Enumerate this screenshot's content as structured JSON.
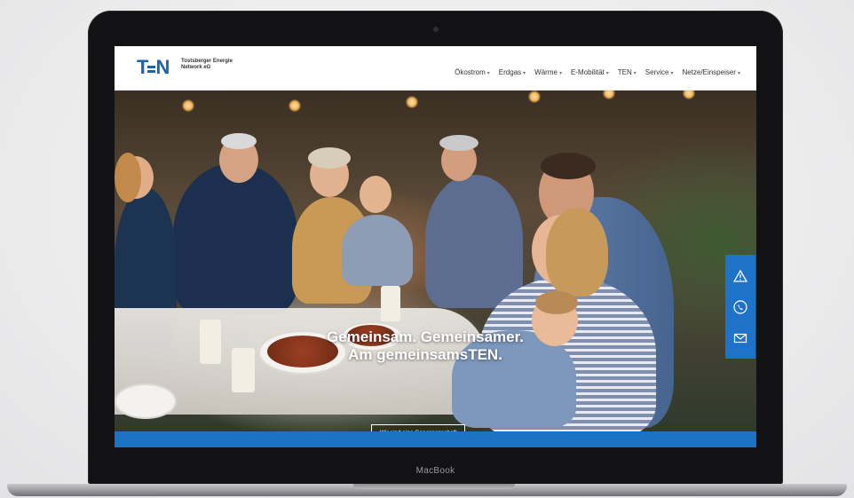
{
  "device": {
    "label": "MacBook"
  },
  "site": {
    "logo": {
      "mark": "TEN",
      "line1": "Tostsberger Energie",
      "line2": "Network eG"
    },
    "nav": [
      {
        "label": "Ökostrom"
      },
      {
        "label": "Erdgas"
      },
      {
        "label": "Wärme"
      },
      {
        "label": "E-Mobilität"
      },
      {
        "label": "TEN"
      },
      {
        "label": "Service"
      },
      {
        "label": "Netze/Einspeiser"
      }
    ],
    "hero": {
      "title_line1": "Gemeinsam. Gemeinsamer.",
      "title_line2": "Am gemeinsamsTEN.",
      "cta": "Wir sind eine Genossenschaft",
      "slides": 3,
      "active_slide": 2
    },
    "side_actions": [
      {
        "icon": "warning-icon"
      },
      {
        "icon": "phone-icon"
      },
      {
        "icon": "mail-icon"
      }
    ],
    "colors": {
      "brand_blue": "#1b64ad",
      "strip_blue": "#1a73c5"
    }
  }
}
